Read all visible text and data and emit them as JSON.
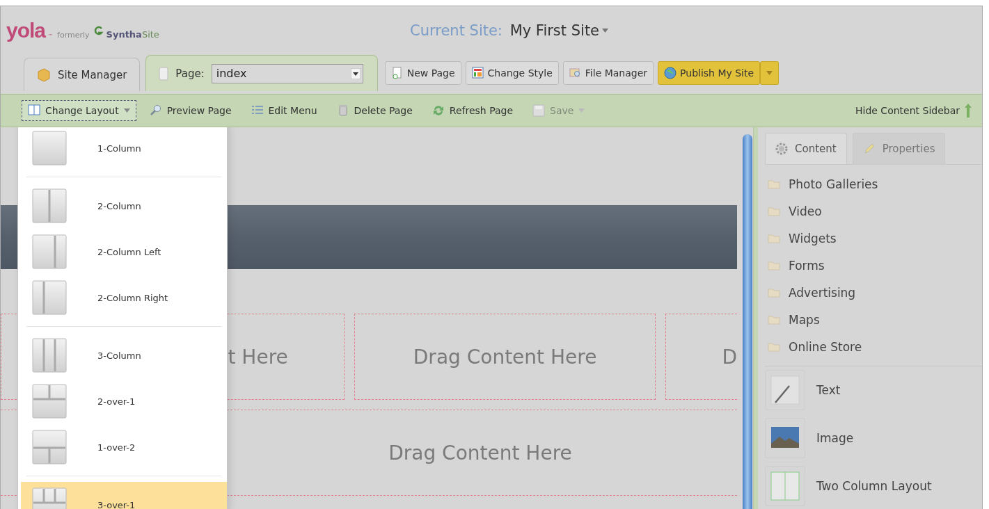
{
  "logo": {
    "brand": "yola",
    "tm": "™",
    "formerly": "formerly",
    "former_brand": "Syntha",
    "former_suffix": "Site"
  },
  "current_site": {
    "label": "Current Site:",
    "name": "My First Site"
  },
  "tabs": [
    {
      "label": "Site Manager",
      "kind": "plain",
      "selected": false
    },
    {
      "label": "Page:",
      "kind": "page",
      "selected": true,
      "value": "index"
    }
  ],
  "actions": [
    {
      "label": "New Page",
      "kind": "normal"
    },
    {
      "label": "Change Style",
      "kind": "normal"
    },
    {
      "label": "File Manager",
      "kind": "normal"
    },
    {
      "label": "Publish My Site",
      "kind": "primary"
    }
  ],
  "toolbar": [
    {
      "label": "Change Layout",
      "kind": "dropdown",
      "expanded": true,
      "disabled": false
    },
    {
      "label": "Preview Page",
      "kind": "plain",
      "expanded": false,
      "disabled": false
    },
    {
      "label": "Edit Menu",
      "kind": "plain",
      "expanded": false,
      "disabled": false
    },
    {
      "label": "Delete Page",
      "kind": "plain",
      "expanded": false,
      "disabled": false
    },
    {
      "label": "Refresh Page",
      "kind": "plain",
      "expanded": false,
      "disabled": false
    },
    {
      "label": "Save",
      "kind": "dropdown",
      "expanded": false,
      "disabled": true
    }
  ],
  "hide_sidebar": "Hide Content Sidebar",
  "layout_menu": {
    "groups": [
      [
        {
          "label": "1-Column",
          "kind": "single",
          "selected": false
        }
      ],
      [
        {
          "label": "2-Column",
          "kind": "halves",
          "selected": false
        },
        {
          "label": "2-Column Left",
          "kind": "wideleft",
          "selected": false
        },
        {
          "label": "2-Column Right",
          "kind": "wideright",
          "selected": false
        }
      ],
      [
        {
          "label": "3-Column",
          "kind": "thirds",
          "selected": false
        },
        {
          "label": "2-over-1",
          "kind": "twoovertone",
          "selected": false
        },
        {
          "label": "1-over-2",
          "kind": "oneovertwo",
          "selected": false
        }
      ],
      [
        {
          "label": "3-over-1",
          "kind": "threeoverone",
          "selected": true
        }
      ]
    ]
  },
  "canvas": {
    "zone_rows": [
      [
        "t Here",
        "Drag Content Here",
        "D"
      ],
      [
        "Drag Content Here"
      ]
    ]
  },
  "sidebar": {
    "tabs": [
      {
        "label": "Content",
        "selected": true
      },
      {
        "label": "Properties",
        "selected": false
      }
    ],
    "categories": [
      "Photo Galleries",
      "Video",
      "Widgets",
      "Forms",
      "Advertising",
      "Maps",
      "Online Store"
    ],
    "widgets": [
      {
        "label": "Text",
        "kind": "text"
      },
      {
        "label": "Image",
        "kind": "image"
      },
      {
        "label": "Two Column Layout",
        "kind": "columns"
      }
    ]
  }
}
